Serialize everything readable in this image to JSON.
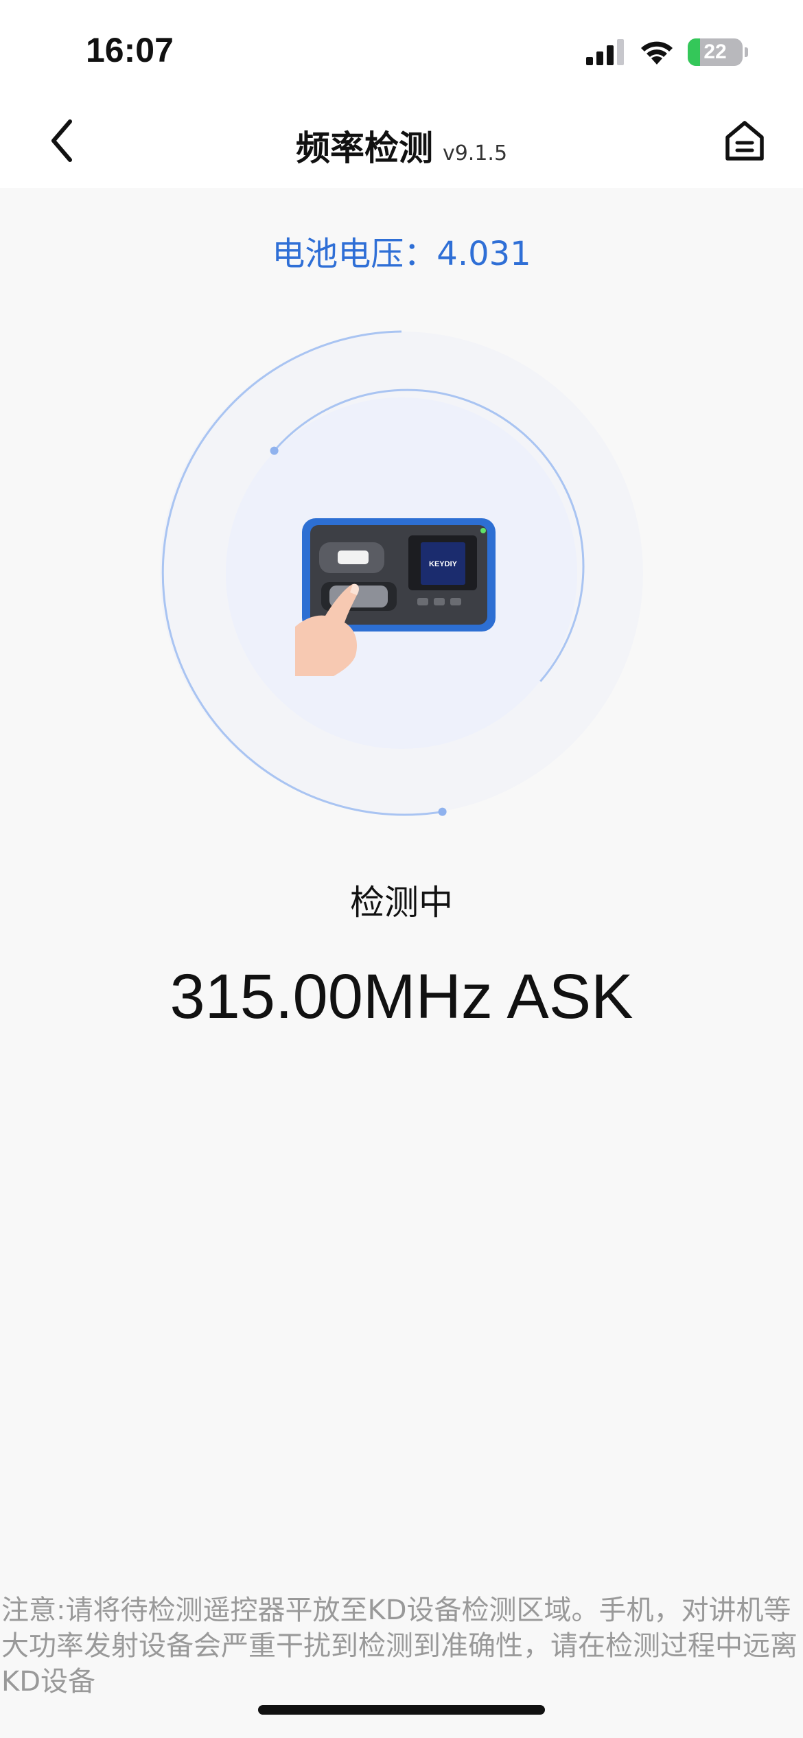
{
  "status_bar": {
    "time": "16:07",
    "battery_level": "22",
    "battery_fraction": 0.22,
    "icons": [
      "cellular-signal-icon",
      "wifi-icon",
      "battery-charging-icon"
    ]
  },
  "header": {
    "title": "频率检测",
    "version": "v9.1.5",
    "back_icon": "chevron-left-icon",
    "home_icon": "home-icon"
  },
  "battery_voltage": {
    "label": "电池电压：",
    "value": "4.031"
  },
  "detection": {
    "status": "检测中",
    "result": "315.00MHz ASK",
    "device_brand": "KEYDIY"
  },
  "notice": "注意:请将待检测遥控器平放至KD设备检测区域。手机，对讲机等大功率发射设备会严重干扰到检测到准确性，请在检测过程中远离KD设备",
  "colors": {
    "accent": "#2f6fd6",
    "ring": "#a9c4f2",
    "ring_fill": "#eef1fb",
    "background": "#f8f8f8"
  }
}
